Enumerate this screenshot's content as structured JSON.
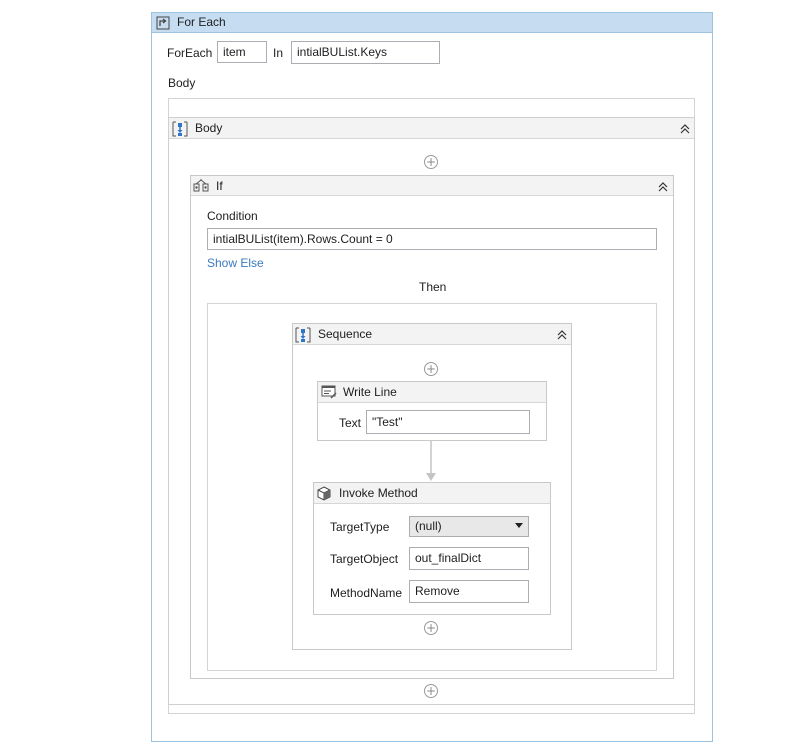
{
  "foreach": {
    "title": "For Each",
    "foreach_label": "ForEach",
    "item_value": "item",
    "in_label": "In",
    "collection_value": "intialBUList.Keys",
    "body_label": "Body"
  },
  "body_sequence": {
    "title": "Body"
  },
  "if_activity": {
    "title": "If",
    "condition_label": "Condition",
    "condition_value": "intialBUList(item).Rows.Count = 0",
    "show_else": "Show Else",
    "then_label": "Then"
  },
  "sequence": {
    "title": "Sequence"
  },
  "write_line": {
    "title": "Write Line",
    "text_label": "Text",
    "text_value": "\"Test\""
  },
  "invoke_method": {
    "title": "Invoke Method",
    "target_type_label": "TargetType",
    "target_type_value": "(null)",
    "target_object_label": "TargetObject",
    "target_object_value": "out_finalDict",
    "method_name_label": "MethodName",
    "method_name_value": "Remove"
  },
  "colors": {
    "foreach_header": "#c6dcf0",
    "link": "#3b7bbf",
    "icon_blue": "#2e75c8"
  },
  "icons": [
    "foreach-icon",
    "sequence-icon",
    "if-icon",
    "writeline-icon",
    "invoke-method-icon",
    "collapse-icon",
    "add-activity-icon",
    "dropdown-arrow-icon"
  ]
}
